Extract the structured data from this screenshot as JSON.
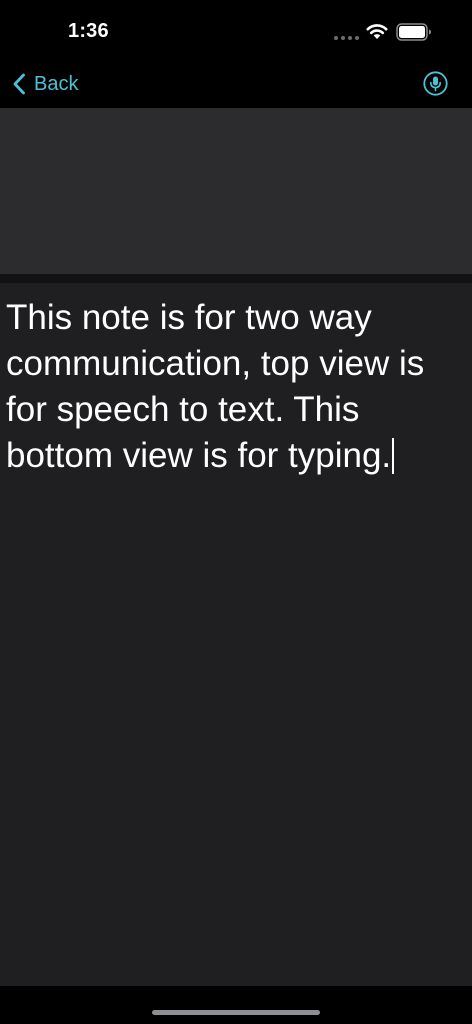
{
  "status_bar": {
    "time": "1:36"
  },
  "nav": {
    "back_label": "Back",
    "back_icon": "chevron-left-icon",
    "mic_icon": "microphone-icon"
  },
  "speech_view": {
    "text": ""
  },
  "typing_view": {
    "text": "This note is for two way communication, top view is for speech to text. This bottom view is for typing."
  },
  "colors": {
    "accent": "#4ec0d6",
    "background": "#000000",
    "speech_view_bg": "#2c2c2e",
    "typing_view_bg": "#1f1f21",
    "text": "#ffffff"
  }
}
